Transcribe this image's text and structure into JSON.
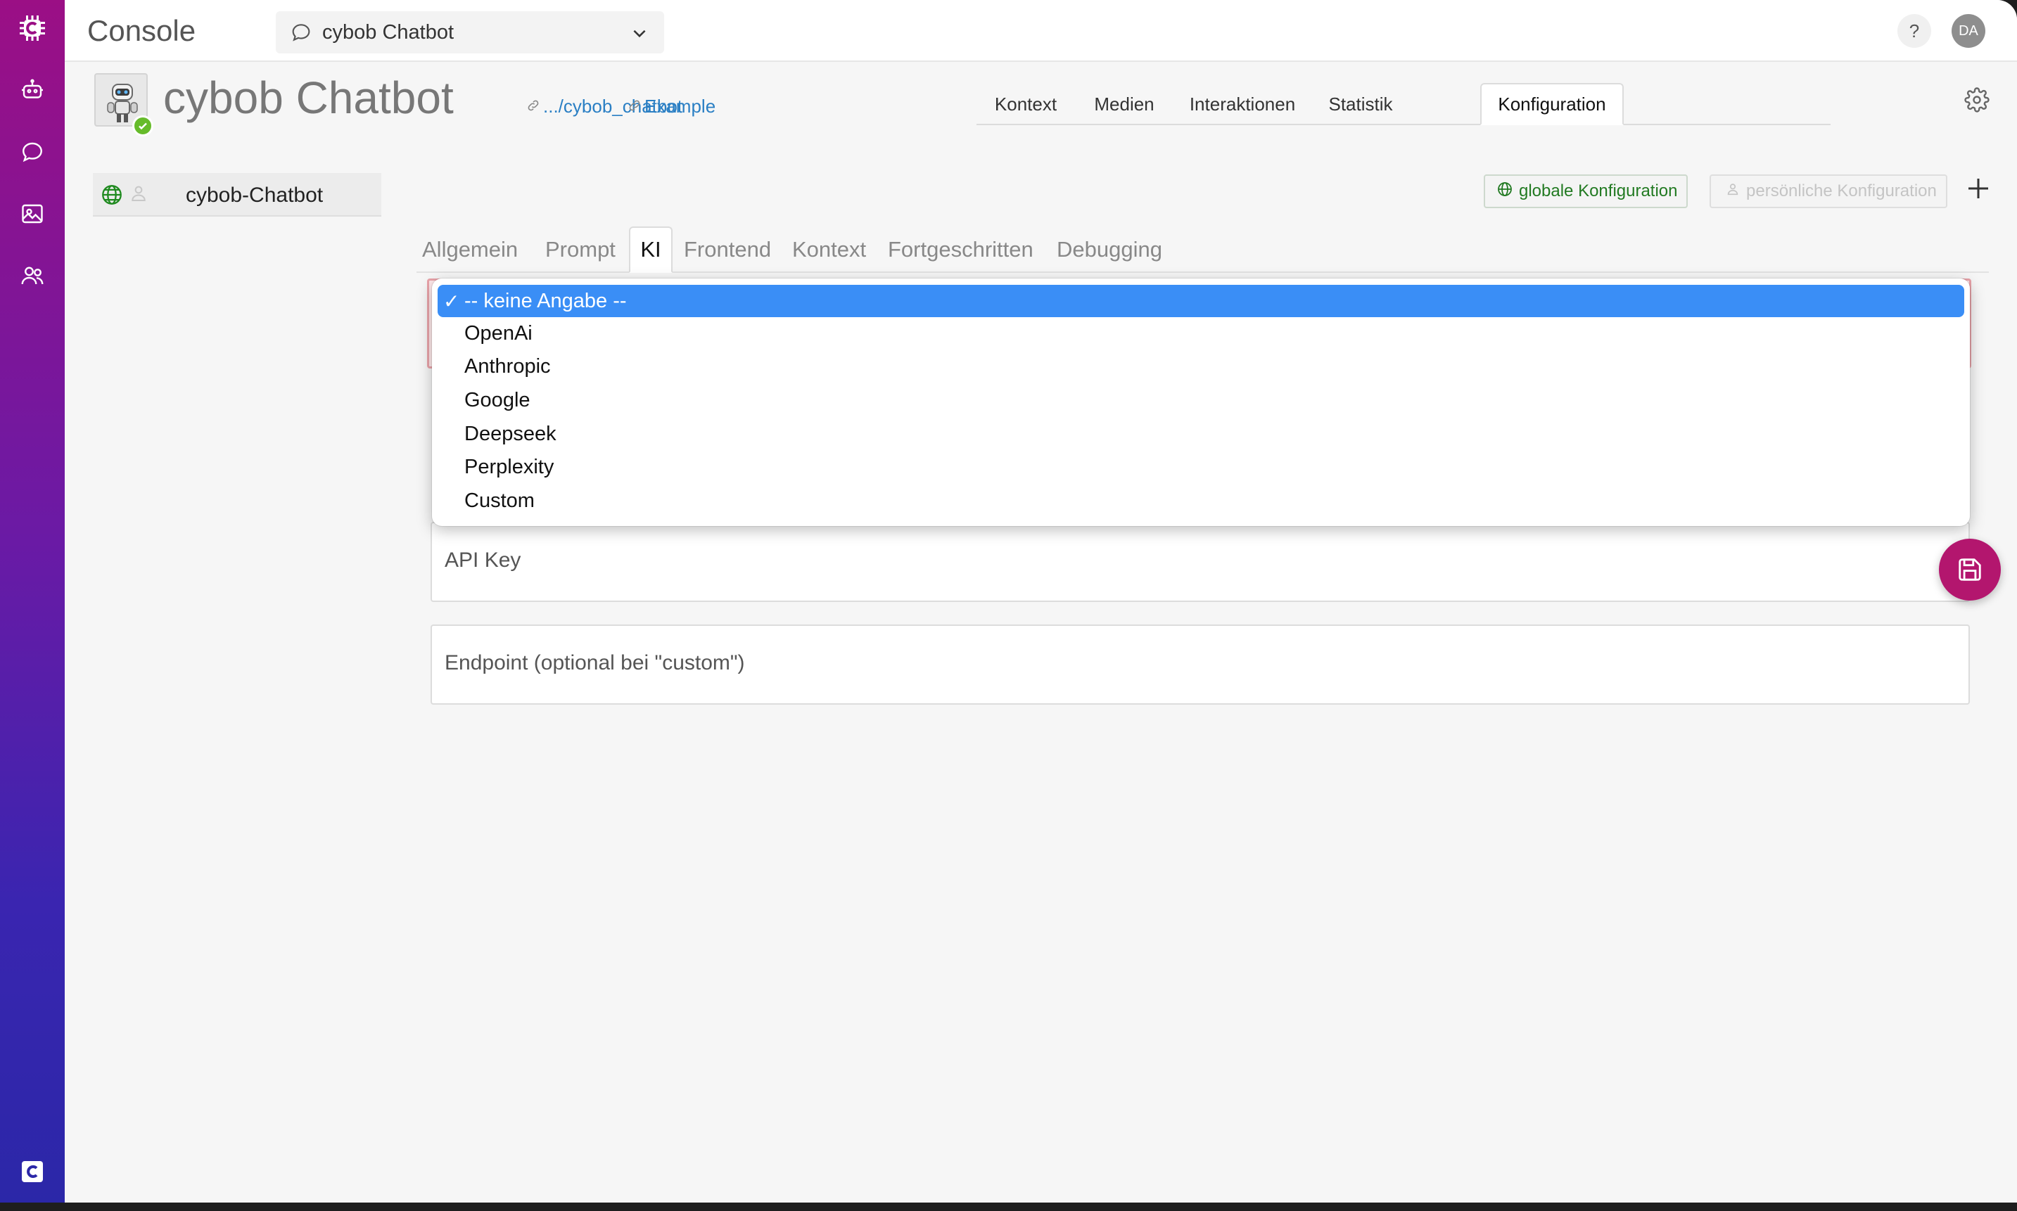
{
  "app": {
    "title": "Console"
  },
  "header": {
    "bot_select_label": "cybob Chatbot",
    "help_label": "?",
    "user_initials": "DA"
  },
  "bot": {
    "title": "cybob Chatbot",
    "path_link": ".../cybob_chatbot",
    "example_link": "Example"
  },
  "main_tabs": [
    {
      "label": "Kontext",
      "active": false
    },
    {
      "label": "Medien",
      "active": false
    },
    {
      "label": "Interaktionen",
      "active": false
    },
    {
      "label": "Statistik",
      "active": false
    },
    {
      "label": "Konfiguration",
      "active": true
    }
  ],
  "config_list": {
    "item_label": "cybob-Chatbot"
  },
  "config_buttons": {
    "global": "globale Konfiguration",
    "personal": "persönliche Konfiguration"
  },
  "sub_tabs": [
    {
      "label": "Allgemein",
      "active": false
    },
    {
      "label": "Prompt",
      "active": false
    },
    {
      "label": "KI",
      "active": true
    },
    {
      "label": "Frontend",
      "active": false
    },
    {
      "label": "Kontext",
      "active": false
    },
    {
      "label": "Fortgeschritten",
      "active": false
    },
    {
      "label": "Debugging",
      "active": false
    }
  ],
  "provider_dropdown": {
    "options": [
      "-- keine Angabe --",
      "OpenAi",
      "Anthropic",
      "Google",
      "Deepseek",
      "Perplexity",
      "Custom"
    ],
    "selected_index": 0,
    "check_glyph": "✓"
  },
  "fields": {
    "api_key_label": "API Key",
    "endpoint_label": "Endpoint (optional bei \"custom\")"
  },
  "colors": {
    "accent": "#b3166e",
    "link": "#2a7fc4",
    "selection": "#3a8ef6",
    "success": "#66bb2a",
    "error_bg": "#ffe8ea"
  }
}
